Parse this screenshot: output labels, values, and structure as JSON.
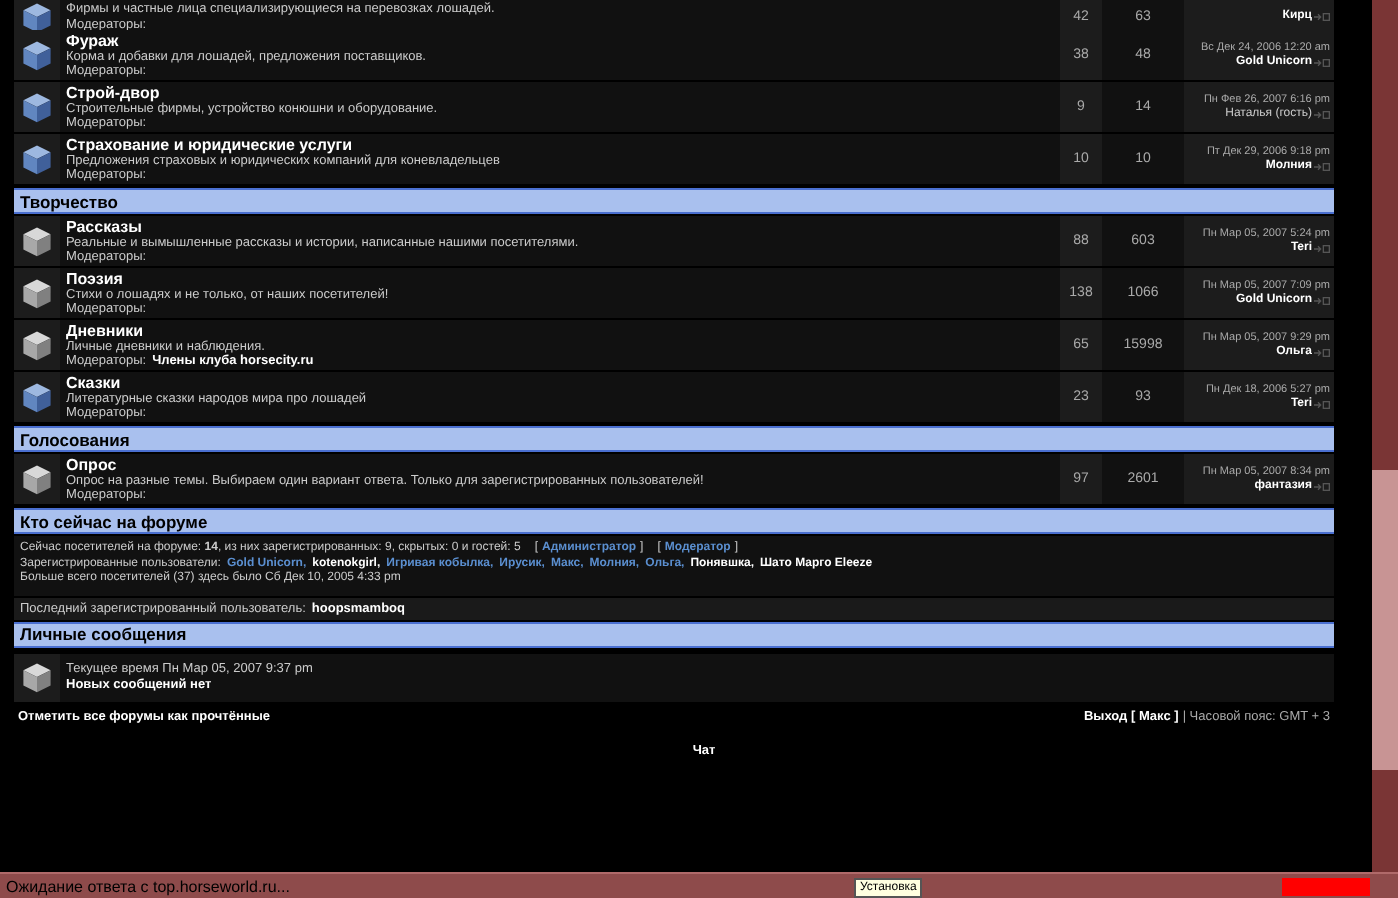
{
  "sections": [
    {
      "forums": [
        {
          "description": "Фирмы и частные лица специализирующиеся на перевозках лошадей.",
          "moderators_label": "Модераторы:",
          "new_posts": true,
          "topics": "42",
          "posts": "63",
          "last_post_author": "Кирц",
          "author_guest": false
        },
        {
          "title": "Фураж",
          "description": "Корма и добавки для лошадей, предложения поставщиков.",
          "moderators_label": "Модераторы:",
          "new_posts": true,
          "topics": "38",
          "posts": "48",
          "last_post_date": "Вс Дек 24, 2006 12:20 am",
          "last_post_author": "Gold Unicorn",
          "author_guest": false
        },
        {
          "title": "Строй-двор",
          "description": "Строительные фирмы, устройство конюшни и оборудование.",
          "moderators_label": "Модераторы:",
          "new_posts": true,
          "topics": "9",
          "posts": "14",
          "last_post_date": "Пн Фев 26, 2007 6:16 pm",
          "last_post_author": "Наталья (гость)",
          "author_guest": true
        },
        {
          "title": "Страхование и юридические услуги",
          "description": "Предложения страховых и юридических компаний для коневладельцев",
          "moderators_label": "Модераторы:",
          "new_posts": true,
          "topics": "10",
          "posts": "10",
          "last_post_date": "Пт Дек 29, 2006 9:18 pm",
          "last_post_author": "Молния",
          "author_guest": false
        }
      ]
    },
    {
      "title": "Творчество",
      "forums": [
        {
          "title": "Рассказы",
          "description": "Реальные и вымышленные рассказы и истории, написанные нашими посетителями.",
          "moderators_label": "Модераторы:",
          "new_posts": false,
          "topics": "88",
          "posts": "603",
          "last_post_date": "Пн Мар 05, 2007 5:24 pm",
          "last_post_author": "Teri",
          "author_guest": false
        },
        {
          "title": "Поэзия",
          "description": "Стихи о лошадях и не только, от наших посетителей!",
          "moderators_label": "Модераторы:",
          "new_posts": false,
          "topics": "138",
          "posts": "1066",
          "last_post_date": "Пн Мар 05, 2007 7:09 pm",
          "last_post_author": "Gold Unicorn",
          "author_guest": false
        },
        {
          "title": "Дневники",
          "description": "Личные дневники и наблюдения.",
          "moderators_label": "Модераторы:",
          "moderators": "Члены клуба horsecity.ru",
          "new_posts": false,
          "topics": "65",
          "posts": "15998",
          "last_post_date": "Пн Мар 05, 2007 9:29 pm",
          "last_post_author": "Ольга",
          "author_guest": false
        },
        {
          "title": "Сказки",
          "description": "Литературные сказки народов мира про лошадей",
          "moderators_label": "Модераторы:",
          "new_posts": true,
          "topics": "23",
          "posts": "93",
          "last_post_date": "Пн Дек 18, 2006 5:27 pm",
          "last_post_author": "Teri",
          "author_guest": false
        }
      ]
    },
    {
      "title": "Голосования",
      "forums": [
        {
          "title": "Опрос",
          "description": "Опрос на разные темы. Выбираем один вариант ответа. Только для зарегистрированных пользователей!",
          "moderators_label": "Модераторы:",
          "new_posts": false,
          "topics": "97",
          "posts": "2601",
          "last_post_date": "Пн Мар 05, 2007 8:34 pm",
          "last_post_author": "фантазия",
          "author_guest": false
        }
      ]
    }
  ],
  "online": {
    "title": "Кто сейчас на форуме",
    "stats": "Сейчас посетителей на форуме: **14**, из них зарегистрированных: 9, скрытых: 0 и гостей: 5",
    "legend": [
      {
        "open": "[",
        "label": "Администратор",
        "close": "]"
      },
      {
        "open": "[",
        "label": "Модератор",
        "close": "]"
      }
    ],
    "users_label": "Зарегистрированные пользователи:",
    "users": [
      {
        "name": "Gold Unicorn,",
        "color": "#5b8fd0"
      },
      {
        "name": "kotenokgirl,",
        "color": "#ffffff"
      },
      {
        "name": "Игривая кобылка,",
        "color": "#5b8fd0"
      },
      {
        "name": "Ирусик,",
        "color": "#5b8fd0"
      },
      {
        "name": "Макс,",
        "color": "#5b8fd0"
      },
      {
        "name": "Молния,",
        "color": "#5b8fd0"
      },
      {
        "name": "Ольга,",
        "color": "#5b8fd0"
      },
      {
        "name": "Понявшка,",
        "color": "#ffffff"
      },
      {
        "name": "Шато Марго Eleeze",
        "color": "#ffffff"
      }
    ],
    "record": "Больше всего посетителей (37) здесь было Сб Дек 10, 2005 4:33 pm",
    "last_registered_label": "Последний зарегистрированный пользователь:",
    "last_registered": "hoopsmamboq"
  },
  "private_messages": {
    "title": "Личные сообщения",
    "current_time": "Текущее время Пн Мар 05, 2007 9:37 pm",
    "status": "Новых сообщений нет",
    "new_posts": false
  },
  "footer": {
    "mark_read": "Отметить все форумы как прочтённые",
    "logout": "Выход [ Макс ]",
    "timezone": "| Часовой пояс: GMT + 3",
    "chat": "Чат"
  },
  "status_bar": {
    "text": "Ожидание ответа с top.horseworld.ru...",
    "tooltip": "Установка",
    "level": 1
  }
}
